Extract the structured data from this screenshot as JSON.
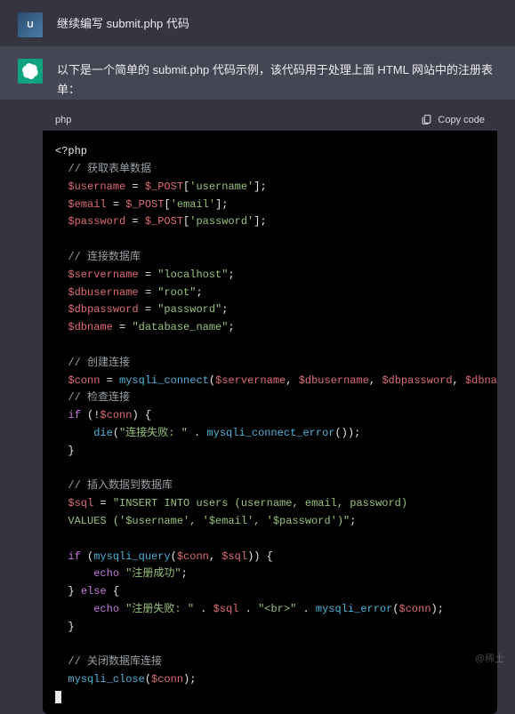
{
  "user_message": "继续编写 submit.php 代码",
  "assistant_intro": "以下是一个简单的 submit.php 代码示例，该代码用于处理上面 HTML 网站中的注册表单：",
  "code_lang": "php",
  "copy_label": "Copy code",
  "watermark": "@稀土",
  "code": {
    "open_tag": "<?php",
    "c1": "// 获取表单数据",
    "l1_a": "$username",
    "l1_b": " = ",
    "l1_c": "$_POST",
    "l1_d": "[",
    "l1_e": "'username'",
    "l1_f": "];",
    "l2_a": "$email",
    "l2_b": " = ",
    "l2_c": "$_POST",
    "l2_d": "[",
    "l2_e": "'email'",
    "l2_f": "];",
    "l3_a": "$password",
    "l3_b": " = ",
    "l3_c": "$_POST",
    "l3_d": "[",
    "l3_e": "'password'",
    "l3_f": "];",
    "c2": "// 连接数据库",
    "l4_a": "$servername",
    "l4_b": " = ",
    "l4_c": "\"localhost\"",
    "l4_d": ";",
    "l5_a": "$dbusername",
    "l5_b": " = ",
    "l5_c": "\"root\"",
    "l5_d": ";",
    "l6_a": "$dbpassword",
    "l6_b": " = ",
    "l6_c": "\"password\"",
    "l6_d": ";",
    "l7_a": "$dbname",
    "l7_b": " = ",
    "l7_c": "\"database_name\"",
    "l7_d": ";",
    "c3": "// 创建连接",
    "l8_a": "$conn",
    "l8_b": " = ",
    "l8_c": "mysqli_connect",
    "l8_d": "(",
    "l8_e": "$servername",
    "l8_f": ", ",
    "l8_g": "$dbusername",
    "l8_h": ", ",
    "l8_i": "$dbpassword",
    "l8_j": ", ",
    "l8_k": "$dbname",
    "l8_l": ");",
    "c4": "// 检查连接",
    "l9_a": "if",
    "l9_b": " (!",
    "l9_c": "$conn",
    "l9_d": ") {",
    "l10_a": "die",
    "l10_b": "(",
    "l10_c": "\"连接失败: \"",
    "l10_d": " . ",
    "l10_e": "mysqli_connect_error",
    "l10_f": "());",
    "l11": "}",
    "c5": "// 插入数据到数据库",
    "l12_a": "$sql",
    "l12_b": " = ",
    "l12_c": "\"INSERT INTO users (username, email, password) ",
    "l12_d": "VALUES ('$username', '$email', '$password')\"",
    "l12_e": ";",
    "l13_a": "if",
    "l13_b": " (",
    "l13_c": "mysqli_query",
    "l13_d": "(",
    "l13_e": "$conn",
    "l13_f": ", ",
    "l13_g": "$sql",
    "l13_h": ")) {",
    "l14_a": "echo",
    "l14_b": " ",
    "l14_c": "\"注册成功\"",
    "l14_d": ";",
    "l15_a": "} ",
    "l15_b": "else",
    "l15_c": " {",
    "l16_a": "echo",
    "l16_b": " ",
    "l16_c": "\"注册失败: \"",
    "l16_d": " . ",
    "l16_e": "$sql",
    "l16_f": " . ",
    "l16_g": "\"<br>\"",
    "l16_h": " . ",
    "l16_i": "mysqli_error",
    "l16_j": "(",
    "l16_k": "$conn",
    "l16_l": ");",
    "l17": "}",
    "c6": "// 关闭数据库连接",
    "l18_a": "mysqli_close",
    "l18_b": "(",
    "l18_c": "$conn",
    "l18_d": ");"
  }
}
